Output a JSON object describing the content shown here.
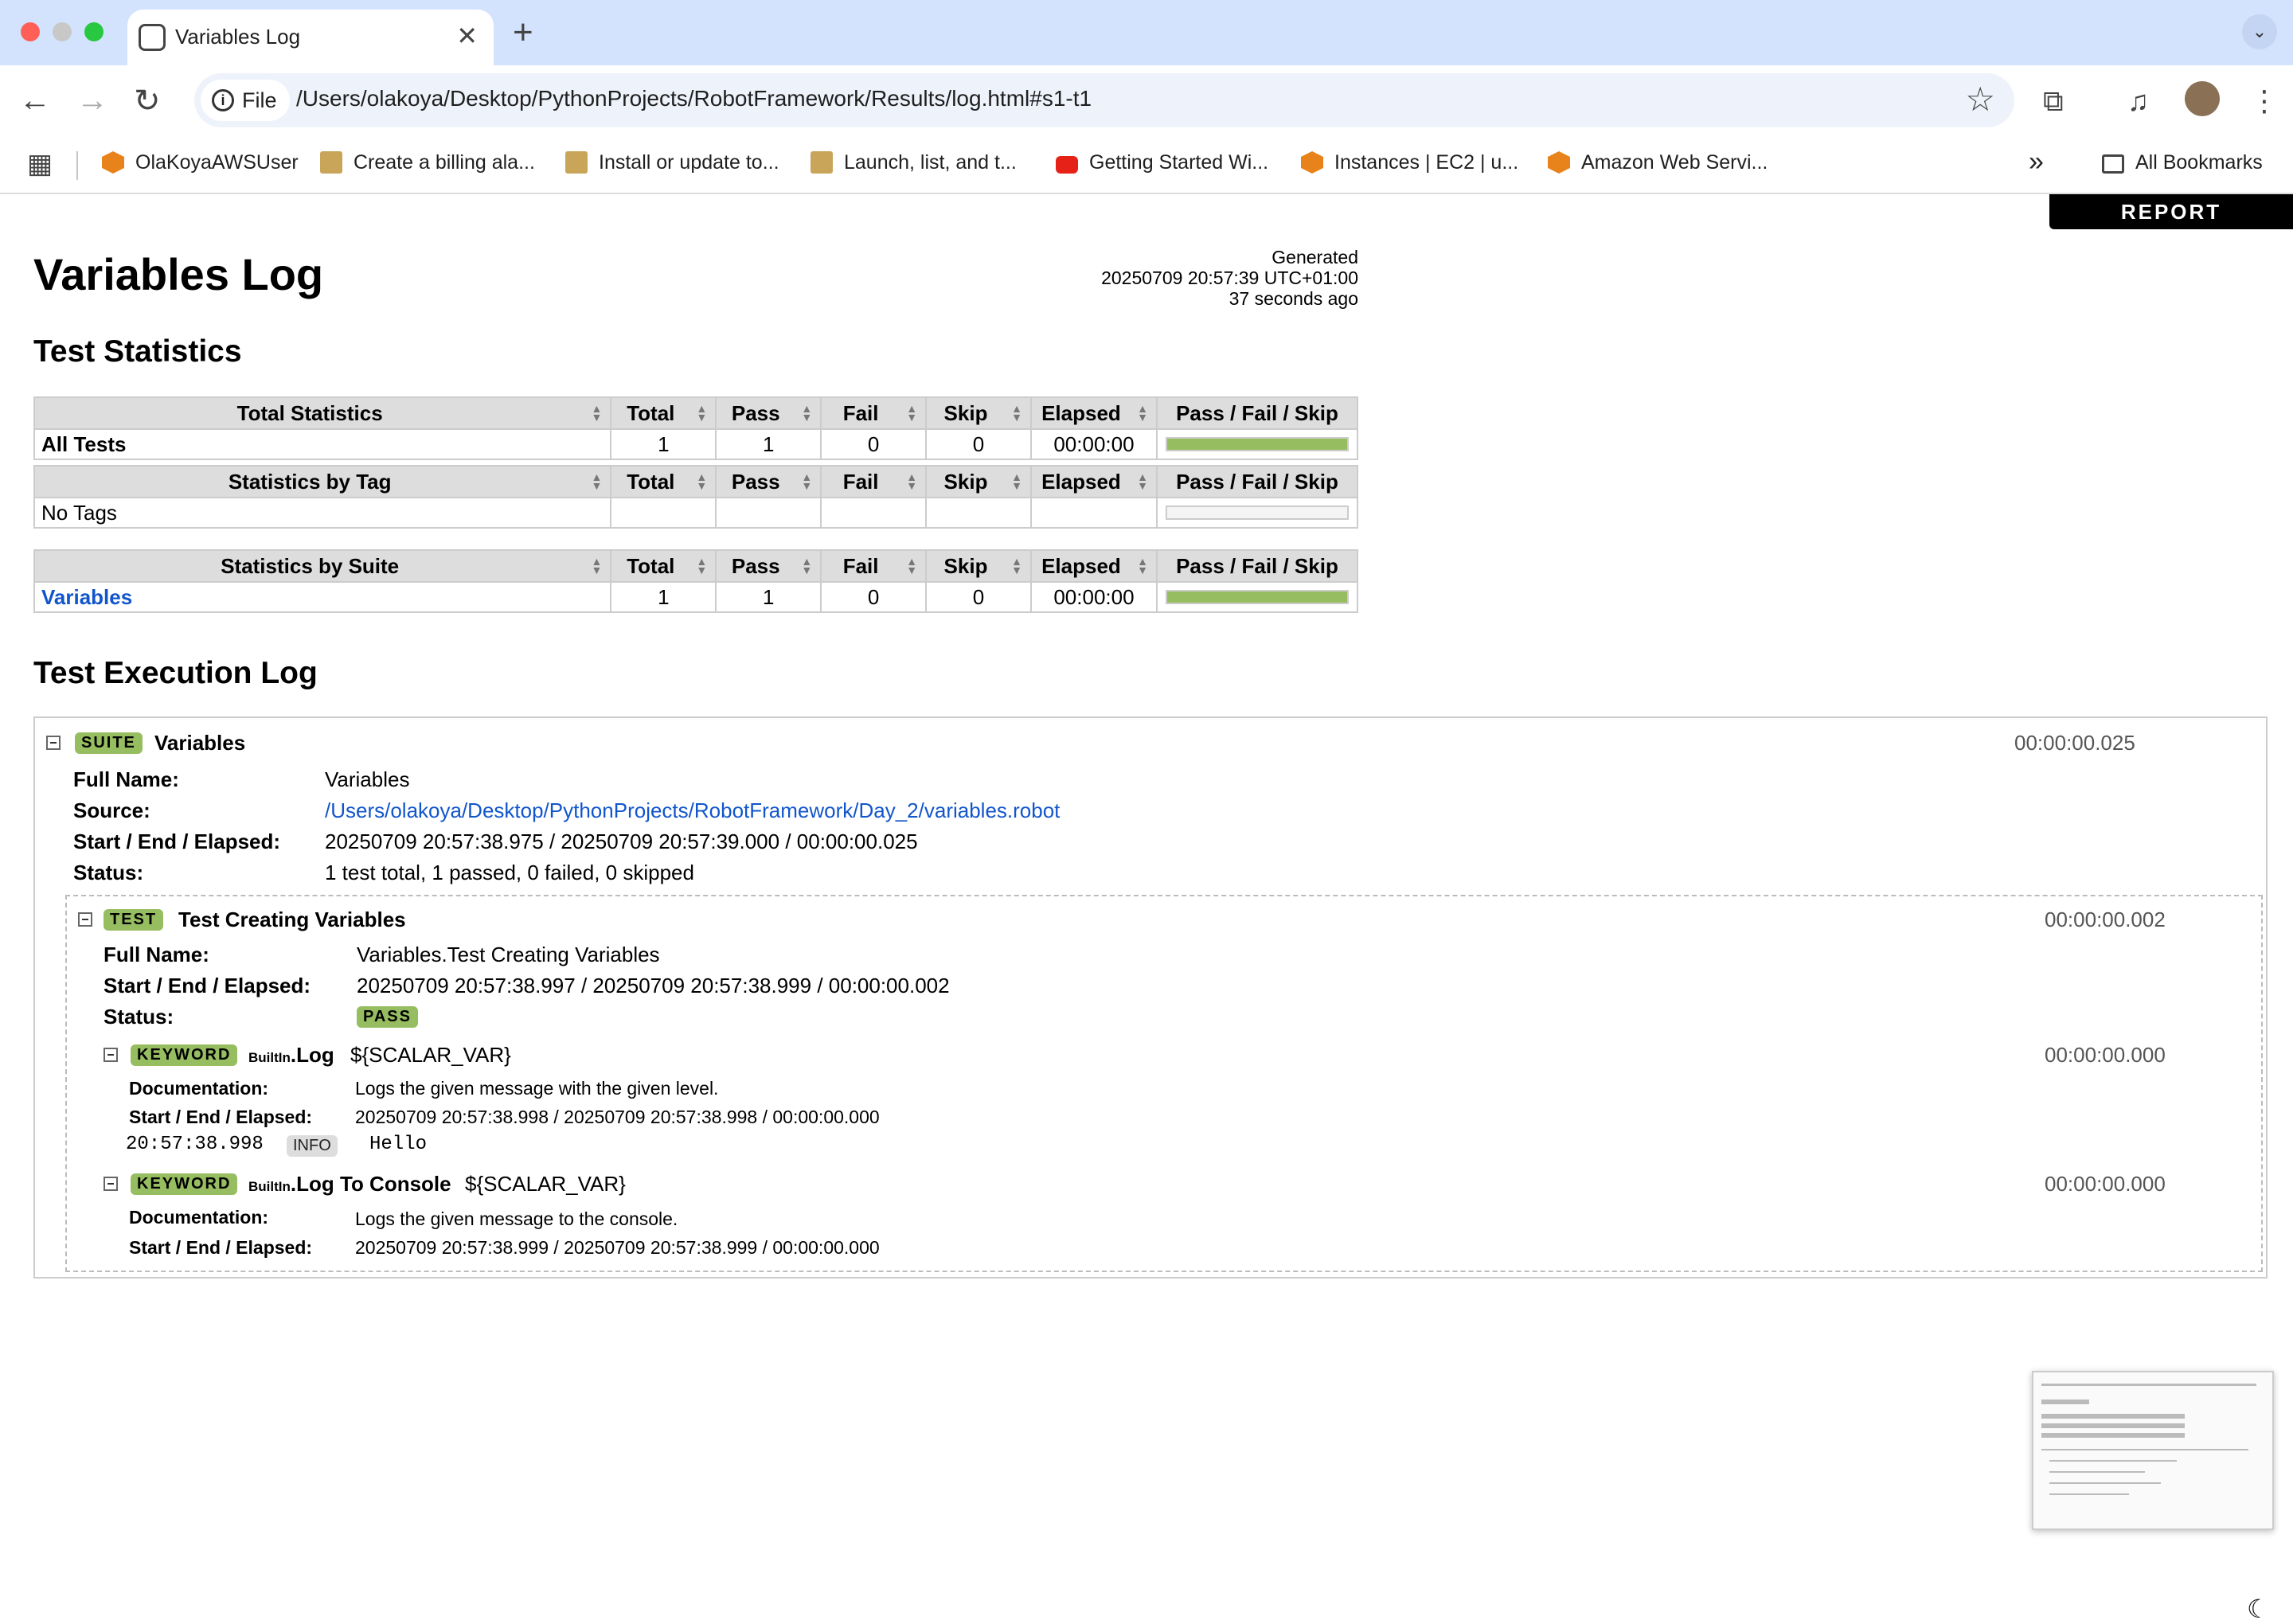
{
  "browser": {
    "tab_title": "Variables Log",
    "tab_close": "✕",
    "new_tab": "+",
    "file_chip": "File",
    "url": "/Users/olakoya/Desktop/PythonProjects/RobotFramework/Results/log.html#s1-t1",
    "bookmarks": [
      {
        "label": "OlaKoyaAWSUser",
        "icon_color": "#e8821a"
      },
      {
        "label": "Create a billing ala...",
        "icon_color": "#c9a55a"
      },
      {
        "label": "Install or update to...",
        "icon_color": "#c9a55a"
      },
      {
        "label": "Launch, list, and t...",
        "icon_color": "#c9a55a"
      },
      {
        "label": "Getting Started Wi...",
        "icon_color": "#e62117"
      },
      {
        "label": "Instances | EC2 | u...",
        "icon_color": "#e8821a"
      },
      {
        "label": "Amazon Web Servi...",
        "icon_color": "#e8821a"
      }
    ],
    "more_bookmarks": "»",
    "all_bookmarks": "All Bookmarks"
  },
  "page": {
    "report_button": "REPORT",
    "title": "Variables Log",
    "generated_label": "Generated",
    "generated_time": "20250709 20:57:39 UTC+01:00",
    "generated_ago": "37 seconds ago",
    "stats_heading": "Test Statistics",
    "exec_heading": "Test Execution Log"
  },
  "stats_tables": [
    {
      "header": [
        "Total Statistics",
        "Total",
        "Pass",
        "Fail",
        "Skip",
        "Elapsed",
        "Pass / Fail / Skip"
      ],
      "row": {
        "name": "All Tests",
        "total": "1",
        "pass": "1",
        "fail": "0",
        "skip": "0",
        "elapsed": "00:00:00",
        "pass_fraction": 1.0
      }
    },
    {
      "header": [
        "Statistics by Tag",
        "Total",
        "Pass",
        "Fail",
        "Skip",
        "Elapsed",
        "Pass / Fail / Skip"
      ],
      "row": {
        "name": "No Tags",
        "total": "",
        "pass": "",
        "fail": "",
        "skip": "",
        "elapsed": "",
        "pass_fraction": 0
      }
    },
    {
      "header": [
        "Statistics by Suite",
        "Total",
        "Pass",
        "Fail",
        "Skip",
        "Elapsed",
        "Pass / Fail / Skip"
      ],
      "row": {
        "name": "Variables",
        "total": "1",
        "pass": "1",
        "fail": "0",
        "skip": "0",
        "elapsed": "00:00:00",
        "pass_fraction": 1.0
      }
    }
  ],
  "suite": {
    "label": "SUITE",
    "name": "Variables",
    "elapsed": "00:00:00.025",
    "full_name_label": "Full Name:",
    "full_name": "Variables",
    "source_label": "Source:",
    "source": "/Users/olakoya/Desktop/PythonProjects/RobotFramework/Day_2/variables.robot",
    "times_label": "Start / End / Elapsed:",
    "times": "20250709 20:57:38.975 / 20250709 20:57:39.000 / 00:00:00.025",
    "status_label": "Status:",
    "status": "1 test total, 1 passed, 0 failed, 0 skipped"
  },
  "test": {
    "label": "TEST",
    "name": "Test Creating Variables",
    "elapsed": "00:00:00.002",
    "full_name_label": "Full Name:",
    "full_name": "Variables.Test Creating Variables",
    "times_label": "Start / End / Elapsed:",
    "times": "20250709 20:57:38.997 / 20250709 20:57:38.999 / 00:00:00.002",
    "status_label": "Status:",
    "status": "PASS"
  },
  "keywords": [
    {
      "label": "KEYWORD",
      "library": "BuiltIn",
      "name": "Log",
      "arg": "${SCALAR_VAR}",
      "elapsed": "00:00:00.000",
      "doc_label": "Documentation:",
      "doc": "Logs the given message with the given level.",
      "times_label": "Start / End / Elapsed:",
      "times": "20250709 20:57:38.998 / 20250709 20:57:38.998 / 00:00:00.000",
      "message_time": "20:57:38.998",
      "message_level": "INFO",
      "message": "Hello"
    },
    {
      "label": "KEYWORD",
      "library": "BuiltIn",
      "name": "Log To Console",
      "arg": "${SCALAR_VAR}",
      "elapsed": "00:00:00.000",
      "doc_label": "Documentation:",
      "doc": "Logs the given message to the console.",
      "times_label": "Start / End / Elapsed:",
      "times": "20250709 20:57:38.999 / 20250709 20:57:38.999 / 00:00:00.000"
    }
  ]
}
